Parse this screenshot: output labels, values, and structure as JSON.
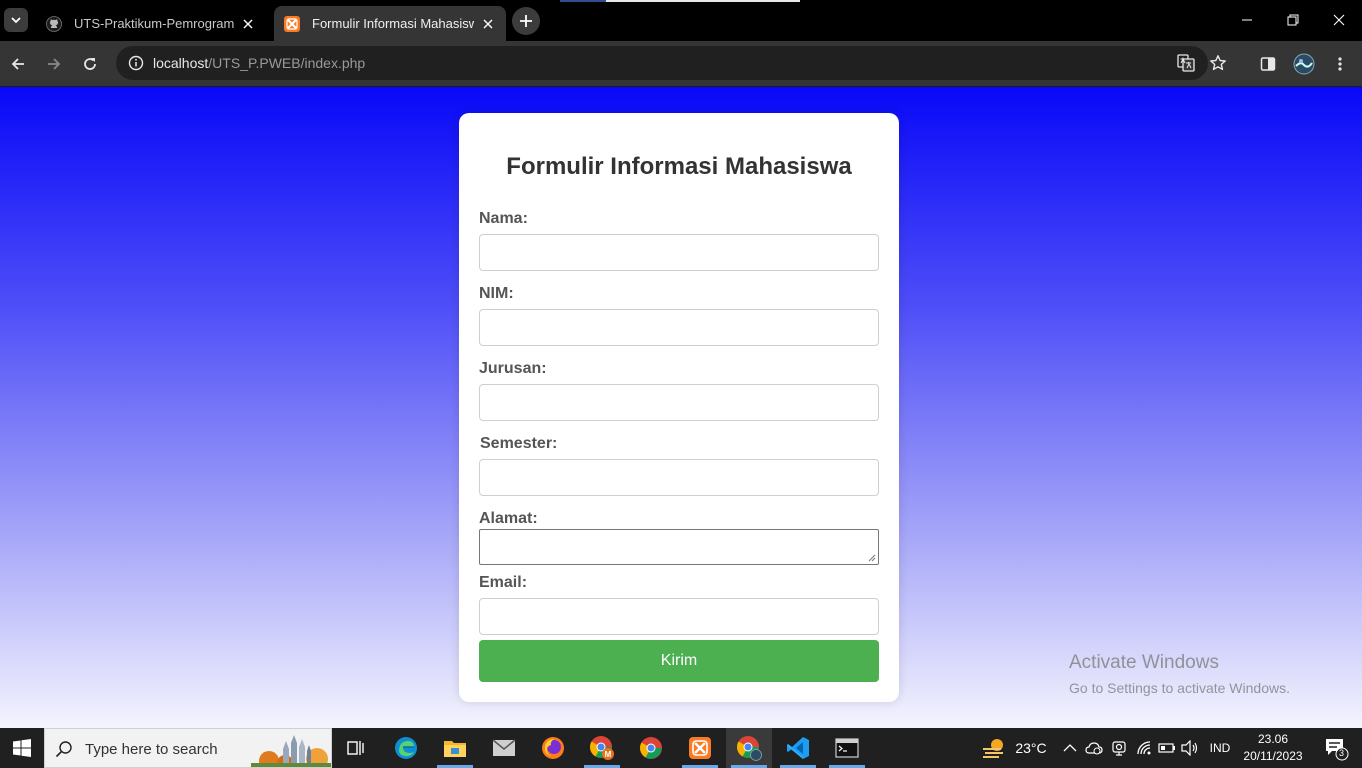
{
  "browser": {
    "tabs": [
      {
        "title": "UTS-Praktikum-Pemrograman-W",
        "icon": "github-icon",
        "active": false
      },
      {
        "title": "Formulir Informasi Mahasiswa",
        "icon": "xampp-icon",
        "active": true
      }
    ],
    "url_host": "localhost",
    "url_path": "/UTS_P.PWEB/index.php"
  },
  "form": {
    "title": "Formulir Informasi Mahasiswa",
    "fields": {
      "nama": {
        "label": "Nama:",
        "value": ""
      },
      "nim": {
        "label": "NIM:",
        "value": ""
      },
      "jurusan": {
        "label": "Jurusan:",
        "value": ""
      },
      "semester": {
        "label": "Semester:",
        "value": ""
      },
      "alamat": {
        "label": "Alamat:",
        "value": ""
      },
      "email": {
        "label": "Email:",
        "value": ""
      }
    },
    "submit_label": "Kirim",
    "submit_color": "#4caf50"
  },
  "watermark": {
    "line1": "Activate Windows",
    "line2": "Go to Settings to activate Windows."
  },
  "taskbar": {
    "search_placeholder": "Type here to search",
    "weather_temp": "23°C",
    "language": "IND",
    "time": "23.06",
    "date": "20/11/2023",
    "notification_count": "3"
  },
  "colors": {
    "page_gradient_top": "#0808f8",
    "page_gradient_bottom": "#f4f4fe"
  }
}
